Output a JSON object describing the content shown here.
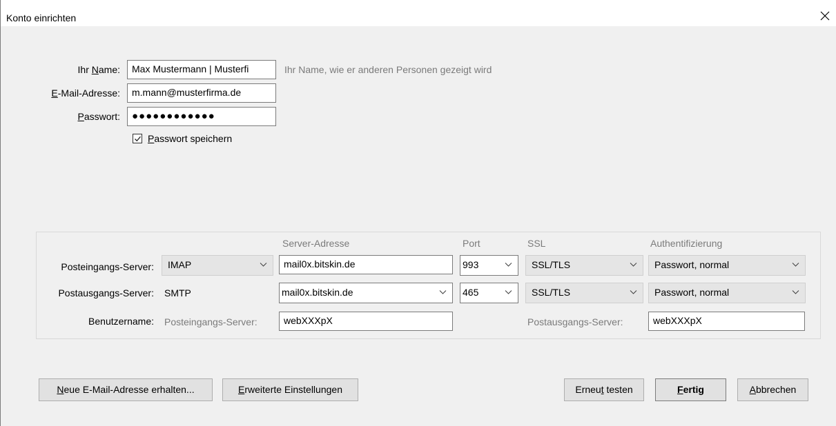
{
  "window": {
    "title": "Konto einrichten"
  },
  "identity": {
    "name_label_pre": "Ihr ",
    "name_label_u": "N",
    "name_label_post": "ame:",
    "name_value": "Max Mustermann | Musterfi",
    "name_hint": "Ihr Name, wie er anderen Personen gezeigt wird",
    "email_label_u": "E",
    "email_label_post": "-Mail-Adresse:",
    "email_value": "m.mann@musterfirma.de",
    "password_label_u": "P",
    "password_label_post": "asswort:",
    "password_value": "●●●●●●●●●●●●",
    "save_password_u": "P",
    "save_password_post": "asswort speichern",
    "save_password_checked": true
  },
  "server": {
    "headers": {
      "address": "Server-Adresse",
      "port": "Port",
      "ssl": "SSL",
      "auth": "Authentifizierung"
    },
    "incoming": {
      "label": "Posteingangs-Server:",
      "protocol": "IMAP",
      "address": "mail0x.bitskin.de",
      "port": "993",
      "ssl": "SSL/TLS",
      "auth": "Passwort, normal"
    },
    "outgoing": {
      "label": "Postausgangs-Server:",
      "protocol": "SMTP",
      "address": "mail0x.bitskin.de",
      "port": "465",
      "ssl": "SSL/TLS",
      "auth": "Passwort, normal"
    },
    "username": {
      "label": "Benutzername:",
      "incoming_label": "Posteingangs-Server:",
      "incoming_value": "webXXXpX",
      "outgoing_label": "Postausgangs-Server:",
      "outgoing_value": "webXXXpX"
    }
  },
  "buttons": {
    "new_address_u": "N",
    "new_address_post": "eue E-Mail-Adresse erhalten...",
    "advanced_u": "E",
    "advanced_post": "rweiterte Einstellungen",
    "retest_pre": "Erneu",
    "retest_u": "t",
    "retest_post": " testen",
    "done_u": "F",
    "done_post": "ertig",
    "cancel_u": "A",
    "cancel_post": "bbrechen"
  },
  "colors": {
    "dialog_bg": "#f0f0f0",
    "button_bg": "#e1e1e1",
    "hint_text": "#7a7a7a"
  }
}
